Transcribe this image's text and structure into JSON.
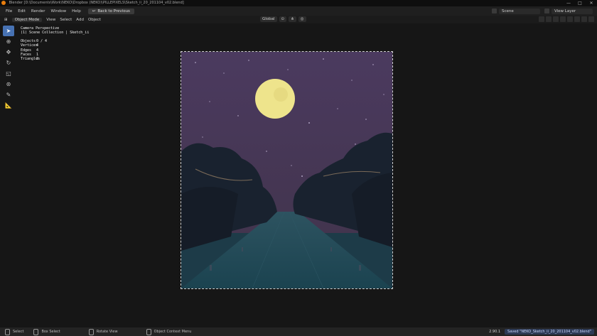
{
  "window": {
    "title": "Blender [D:\\Documents\\Work\\NEKO\\Dropbox (NEKO)\\PILLEPIXELS\\Sketch_ii_20_201104_v02.blend]",
    "controls": [
      "—",
      "□",
      "✕"
    ]
  },
  "menubar": {
    "items": [
      "File",
      "Edit",
      "Render",
      "Window",
      "Help"
    ],
    "back_button": "Back to Previous",
    "scene": "Scene",
    "view_layer": "View Layer"
  },
  "header": {
    "mode": "Object Mode",
    "menus": [
      "View",
      "Select",
      "Add",
      "Object"
    ],
    "transform_orientation": "Global"
  },
  "toolbar": {
    "tools": [
      "select-box",
      "cursor",
      "move",
      "rotate",
      "scale",
      "transform",
      "annotate",
      "measure"
    ],
    "active_index": 0
  },
  "viewport": {
    "view_name": "Camera Perspective",
    "collection": "(1) Scene Collection | Sketch_ii",
    "stats": [
      {
        "label": "Objects",
        "value": "0 / 4"
      },
      {
        "label": "Vertices",
        "value": "4"
      },
      {
        "label": "Edges",
        "value": "4"
      },
      {
        "label": "Faces",
        "value": "1"
      },
      {
        "label": "Triangles",
        "value": "2"
      }
    ]
  },
  "statusbar": {
    "items": [
      "Select",
      "Box Select",
      "Rotate View",
      "Object Context Menu"
    ],
    "version": "2.90.1",
    "saved": "Saved \"NEKO_Sketch_ii_20_201104_v02.blend\""
  },
  "colors": {
    "sky": "#4a3a5e",
    "moon": "#ede58a",
    "road": "#1f4550",
    "trees": "#17202c",
    "active_tool": "#4772b3"
  }
}
